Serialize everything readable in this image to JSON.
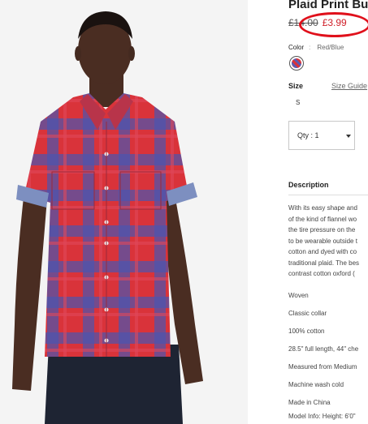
{
  "product": {
    "title": "Plaid Print Bu",
    "old_price": "£14.00",
    "new_price": "£3.99",
    "color_label": "Color",
    "color_separator": ":",
    "color_value": "Red/Blue",
    "size_label": "Size",
    "size_guide": "Size Guide",
    "size_option": "S",
    "qty_text": "Qty : 1",
    "description_heading": "Description",
    "description_lines": [
      "With its easy shape and",
      "of the kind of flannel wo",
      "the tire pressure on the",
      "to be wearable outside t",
      "cotton and dyed with co",
      "traditional plaid. The bes",
      "contrast cotton oxford ("
    ],
    "features": [
      "Woven",
      "Classic collar",
      "100% cotton",
      "28.5\" full length, 44\" che",
      "Measured from Medium",
      "Machine wash cold",
      "Made in China",
      "Model Info: Height: 6'0\""
    ]
  },
  "icons": {
    "qty_caret": "caret-down-icon",
    "color_swatch": "plaid-swatch-icon"
  },
  "colors": {
    "price_red": "#d0202a",
    "highlight_circle": "#e0101b",
    "shirt_red": "#d9333a",
    "shirt_blue": "#4a56b0"
  }
}
